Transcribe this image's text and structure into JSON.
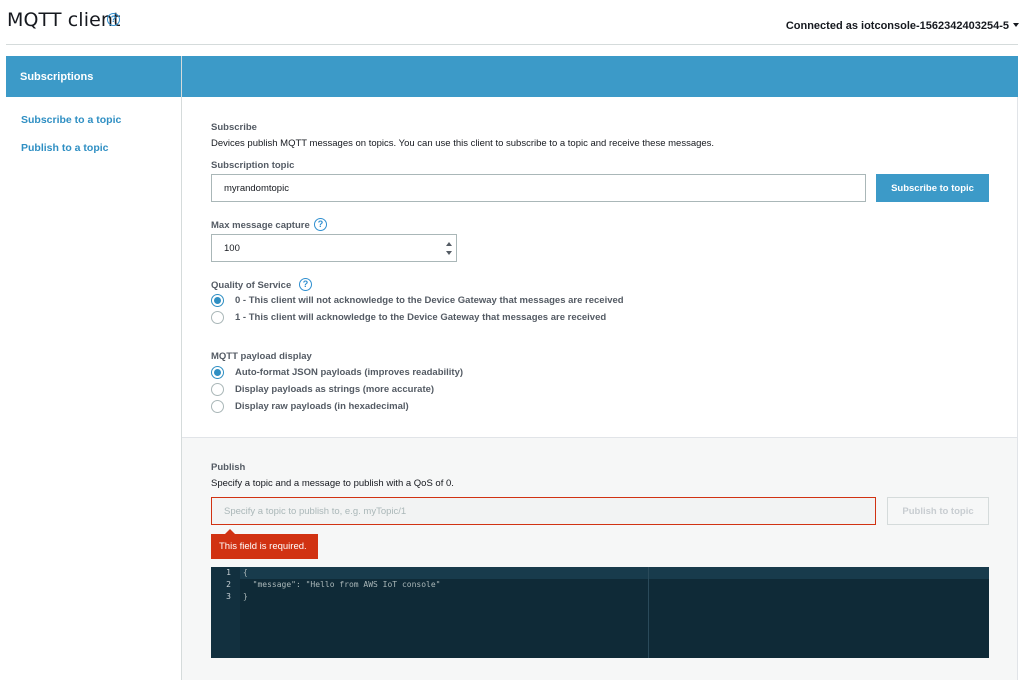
{
  "header": {
    "title": "MQTT client",
    "account_label": "Connected as iotconsole-1562342403254-5"
  },
  "sidebar": {
    "header": "Subscriptions",
    "items": [
      {
        "label": "Subscribe to a topic"
      },
      {
        "label": "Publish to a topic"
      }
    ]
  },
  "subscribe": {
    "section_label": "Subscribe",
    "description": "Devices publish MQTT messages on topics. You can use this client to subscribe to a topic and receive these messages.",
    "topic_label": "Subscription topic",
    "topic_value": "myrandomtopic",
    "subscribe_button": "Subscribe to topic",
    "max_capture_label": "Max message capture",
    "max_capture_value": "100",
    "qos_label": "Quality of Service",
    "qos_options": [
      {
        "label": "0 - This client will not acknowledge to the Device Gateway that messages are received",
        "selected": true
      },
      {
        "label": "1 - This client will acknowledge to the Device Gateway that messages are received",
        "selected": false
      }
    ],
    "payload_label": "MQTT payload display",
    "payload_options": [
      {
        "label": "Auto-format JSON payloads (improves readability)",
        "selected": true
      },
      {
        "label": "Display payloads as strings (more accurate)",
        "selected": false
      },
      {
        "label": "Display raw payloads (in hexadecimal)",
        "selected": false
      }
    ]
  },
  "publish": {
    "section_label": "Publish",
    "description": "Specify a topic and a message to publish with a QoS of 0.",
    "topic_placeholder": "Specify a topic to publish to, e.g. myTopic/1",
    "publish_button": "Publish to topic",
    "error_message": "This field is required.",
    "editor": {
      "line_numbers": [
        "1",
        "2",
        "3"
      ],
      "lines": [
        "{",
        "  \"message\": \"Hello from AWS IoT console\"",
        "}"
      ]
    }
  },
  "colors": {
    "accent": "#3c9ac8",
    "link": "#2f8fc3",
    "error": "#d13212",
    "editor_bg": "#0f2a37"
  }
}
